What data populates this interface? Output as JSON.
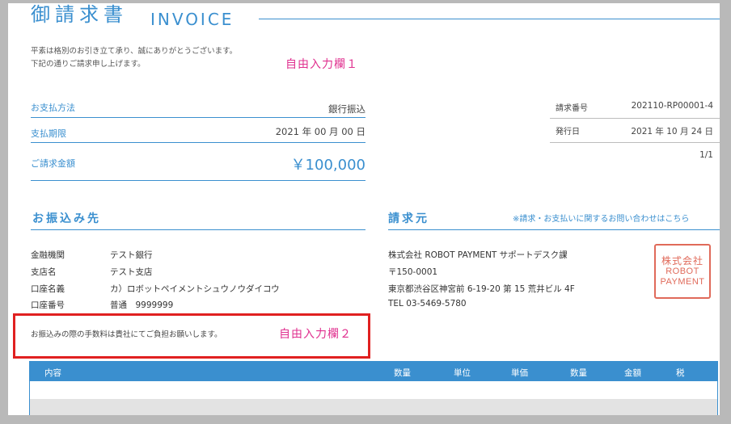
{
  "header": {
    "title_jp": "御請求書",
    "title_en": "INVOICE"
  },
  "greeting": {
    "line1": "平素は格別のお引き立て承り、誠にありがとうございます。",
    "line2": "下記の通りご請求申し上げます。"
  },
  "free_field_1": "自由入力欄１",
  "payment": {
    "method_label": "お支払方法",
    "method_value": "銀行振込",
    "deadline_label": "支払期限",
    "deadline_value": "2021 年 00 月 00 日",
    "amount_label": "ご請求金額",
    "amount_value": "￥100,000"
  },
  "meta": {
    "invoice_no_label": "請求番号",
    "invoice_no_value": "202110-RP00001-4",
    "issue_date_label": "発行日",
    "issue_date_value": "2021 年 10 月 24 日",
    "page": "1/1"
  },
  "bank": {
    "title": "お振込み先",
    "rows": [
      {
        "label": "金融機関",
        "value": "テスト銀行"
      },
      {
        "label": "支店名",
        "value": "テスト支店"
      },
      {
        "label": "口座名義",
        "value": "カ）ロボットペイメントシュウノウダイコウ"
      },
      {
        "label": "口座番号",
        "value": "普通　9999999"
      }
    ],
    "note": "お振込みの際の手数料は貴社にてご負担お願いします。"
  },
  "free_field_2": "自由入力欄２",
  "issuer": {
    "title": "請求元",
    "contact_link": "※請求・お支払いに関するお問い合わせはこちら",
    "company": "株式会社 ROBOT PAYMENT サポートデスク課",
    "postal": "〒150-0001",
    "address": "東京都渋谷区神宮前 6-19-20 第 15 荒井ビル 4F",
    "tel": "TEL  03-5469-5780",
    "stamp": {
      "line1": "株式会社",
      "line2": "ROBOT",
      "line3": "PAYMENT"
    }
  },
  "items_table": {
    "headers": [
      "内容",
      "数量",
      "単位",
      "単価",
      "数量",
      "金額",
      "税"
    ]
  },
  "colors": {
    "accent": "#3a8fcf",
    "free_field": "#e0308f",
    "highlight": "#e02020",
    "stamp": "#e06a5a"
  }
}
